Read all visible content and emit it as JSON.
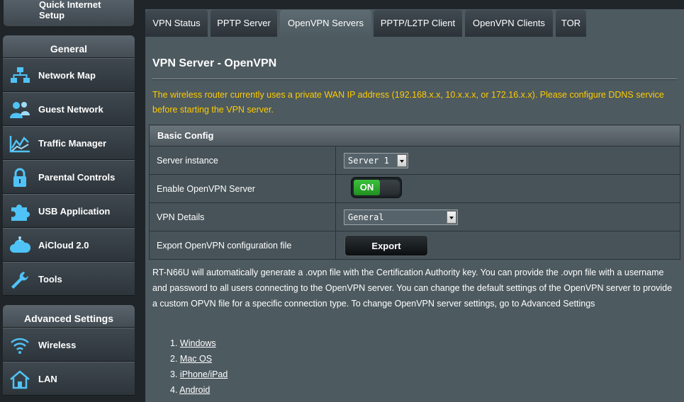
{
  "sidebar": {
    "quick_setup": "Quick Internet Setup",
    "general": {
      "title": "General",
      "items": [
        {
          "label": "Network Map",
          "icon": "network-map-icon"
        },
        {
          "label": "Guest Network",
          "icon": "guest-network-icon"
        },
        {
          "label": "Traffic Manager",
          "icon": "traffic-manager-icon"
        },
        {
          "label": "Parental Controls",
          "icon": "lock-icon"
        },
        {
          "label": "USB Application",
          "icon": "puzzle-icon"
        },
        {
          "label": "AiCloud 2.0",
          "icon": "cloud-icon"
        },
        {
          "label": "Tools",
          "icon": "wrench-icon"
        }
      ]
    },
    "advanced": {
      "title": "Advanced Settings",
      "items": [
        {
          "label": "Wireless",
          "icon": "wifi-icon"
        },
        {
          "label": "LAN",
          "icon": "home-icon"
        }
      ]
    }
  },
  "tabs": [
    {
      "label": "VPN Status"
    },
    {
      "label": "PPTP Server"
    },
    {
      "label": "OpenVPN Servers",
      "active": true
    },
    {
      "label": "PPTP/L2TP Client"
    },
    {
      "label": "OpenVPN Clients"
    },
    {
      "label": "TOR"
    }
  ],
  "main": {
    "title": "VPN Server - OpenVPN",
    "warning": "The wireless router currently uses a private WAN IP address (192.168.x.x, 10.x.x.x, or 172.16.x.x). Please configure DDNS service before starting the VPN server.",
    "basic_config": {
      "header": "Basic Config",
      "server_instance": {
        "label": "Server instance",
        "value": "Server 1"
      },
      "enable": {
        "label": "Enable OpenVPN Server",
        "state": "ON"
      },
      "vpn_details": {
        "label": "VPN Details",
        "value": "General"
      },
      "export": {
        "label": "Export OpenVPN configuration file",
        "button": "Export"
      }
    },
    "description": "RT-N66U will automatically generate a .ovpn file with the Certification Authority key. You can provide the .ovpn file with a username and password to all users connecting to the OpenVPN server. You can change the default settings of the OpenVPN server to provide a custom OPVN file for a specific connection type. To change OpenVPN server settings, go to Advanced Settings",
    "os_links": [
      {
        "num": "1.",
        "label": "Windows"
      },
      {
        "num": "2.",
        "label": "Mac OS"
      },
      {
        "num": "3.",
        "label": "iPhone/iPad"
      },
      {
        "num": "4.",
        "label": "Android"
      }
    ]
  },
  "colors": {
    "warning": "#ffcc00",
    "toggle_on": "#2faa2f",
    "panel": "#4d5a60",
    "sidebar": "#2b3238"
  }
}
